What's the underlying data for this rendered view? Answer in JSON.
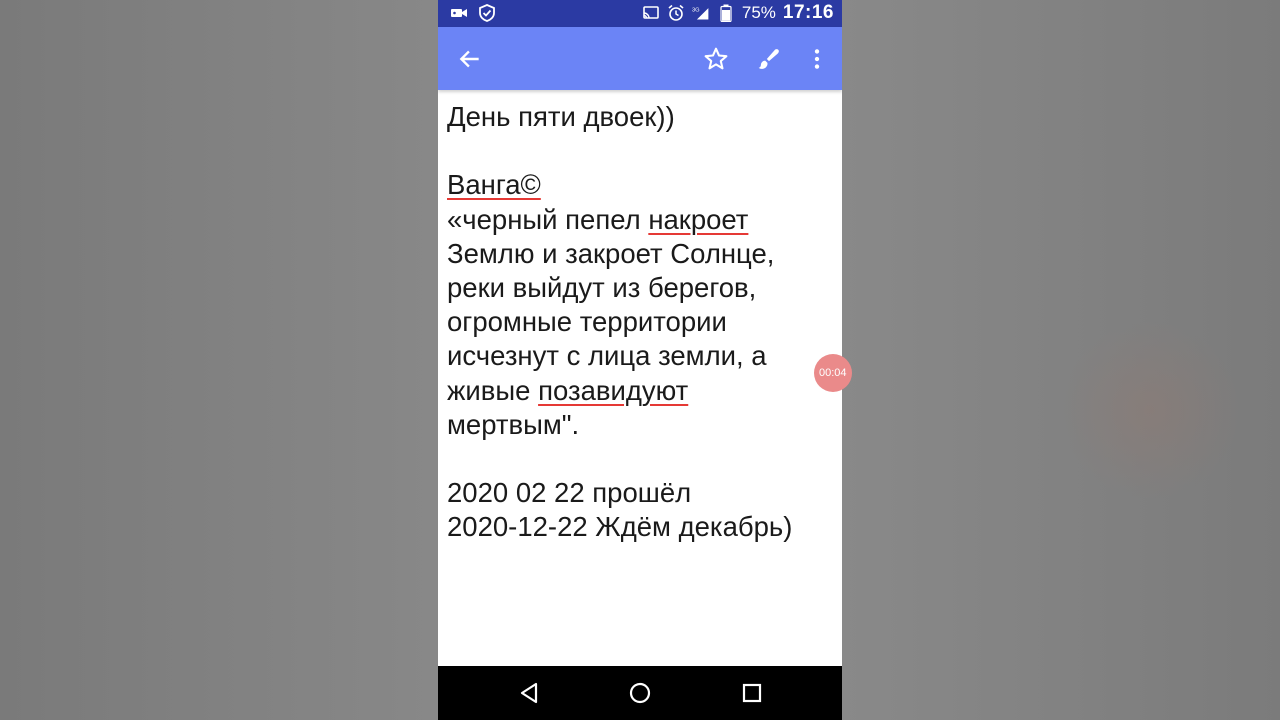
{
  "status_bar": {
    "battery_percent": "75%",
    "time": "17:16",
    "network": "3G",
    "icons": [
      "video-camera-icon",
      "shield-check-icon",
      "cast-icon",
      "alarm-icon",
      "signal-icon",
      "battery-icon"
    ]
  },
  "app_bar": {
    "icons": [
      "back-arrow-icon",
      "star-icon",
      "brush-icon",
      "more-vert-icon"
    ]
  },
  "note": {
    "lines": [
      " День пяти двоек))",
      "",
      "Ванга©",
      "«черный пепел накроет",
      "Землю и закроет Солнце,",
      "реки выйдут из берегов,",
      "огромные территории",
      "исчезнут с лица земли, а",
      "живые позавидуют",
      "мертвым\".",
      "",
      "2020 02 22 прошёл",
      "2020-12-22 Ждём декабрь)"
    ],
    "spellcheck_words": [
      "Ванга©",
      "накроет",
      "позавидуют"
    ]
  },
  "recording_badge": {
    "text": "00:04"
  },
  "nav_bar": {
    "icons": [
      "nav-back-icon",
      "nav-home-icon",
      "nav-recents-icon"
    ]
  },
  "colors": {
    "status_bar": "#2b3aa3",
    "app_bar": "#6b84f6",
    "spellcheck_underline": "#e53935",
    "record_badge": "#ea8a8a"
  }
}
